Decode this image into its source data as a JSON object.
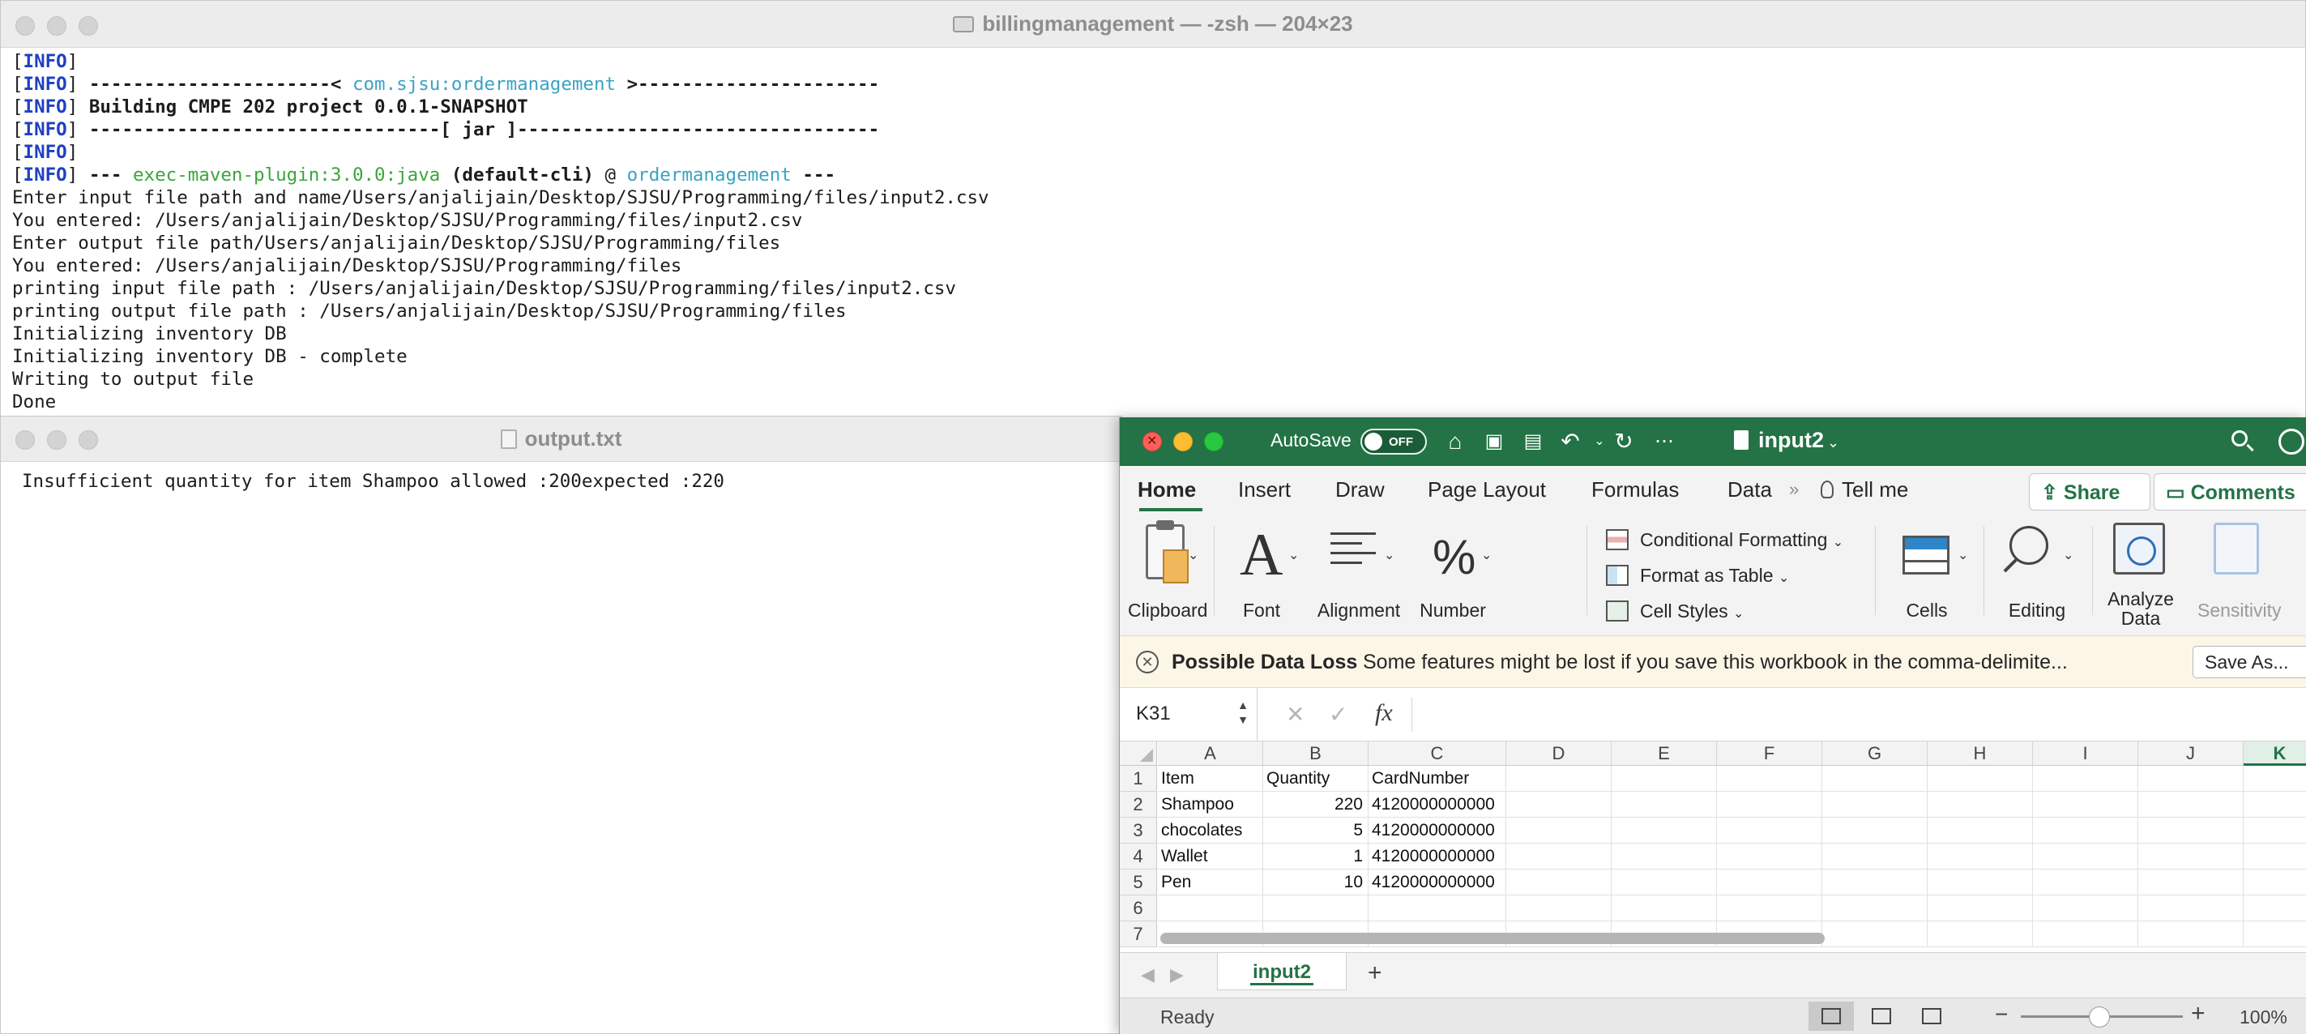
{
  "terminal": {
    "title": "billingmanagement — -zsh — 204×23",
    "lines": [
      {
        "a": "[",
        "b": "INFO",
        "c": "]",
        "d": "",
        "e": "",
        "f": "",
        "g": ""
      },
      {
        "a": "[",
        "b": "INFO",
        "c": "] ",
        "d": "----------------------< ",
        "e": "com.sjsu:ordermanagement",
        "f": " >----------------------",
        "g": ""
      },
      {
        "a": "[",
        "b": "INFO",
        "c": "] ",
        "d": "",
        "e": "",
        "f": "",
        "g": "Building CMPE 202 project 0.0.1-SNAPSHOT"
      },
      {
        "a": "[",
        "b": "INFO",
        "c": "] ",
        "d": "",
        "e": "",
        "f": "",
        "g": "--------------------------------[ jar ]---------------------------------"
      },
      {
        "a": "[",
        "b": "INFO",
        "c": "]",
        "d": "",
        "e": "",
        "f": "",
        "g": ""
      }
    ],
    "plugin_line": {
      "prefix": "[",
      "info": "INFO",
      "close": "] ",
      "dashes1": "--- ",
      "plugin": "exec-maven-plugin:3.0.0:java",
      "cli": " (default-cli)",
      "at": " @ ",
      "module": "ordermanagement",
      "dashes2": " ---"
    },
    "plain_lines": [
      "Enter input file path and name/Users/anjalijain/Desktop/SJSU/Programming/files/input2.csv",
      "You entered: /Users/anjalijain/Desktop/SJSU/Programming/files/input2.csv",
      "Enter output file path/Users/anjalijain/Desktop/SJSU/Programming/files",
      "You entered: /Users/anjalijain/Desktop/SJSU/Programming/files",
      "printing input file path : /Users/anjalijain/Desktop/SJSU/Programming/files/input2.csv",
      "printing output file path : /Users/anjalijain/Desktop/SJSU/Programming/files",
      "Initializing inventory DB",
      "Initializing inventory DB - complete",
      "Writing to output file",
      "Done"
    ]
  },
  "output_window": {
    "title": "output.txt",
    "content": "Insufficient quantity for item Shampoo allowed :200expected :220"
  },
  "excel": {
    "autosave_label": "AutoSave",
    "autosave_state": "OFF",
    "doc_name": "input2",
    "tabs": [
      "Home",
      "Insert",
      "Draw",
      "Page Layout",
      "Formulas",
      "Data"
    ],
    "tell_me": "Tell me",
    "share": "Share",
    "comments": "Comments",
    "ribbon": {
      "clipboard": "Clipboard",
      "font": "Font",
      "alignment": "Alignment",
      "number": "Number",
      "conditional_formatting": "Conditional Formatting",
      "format_as_table": "Format as Table",
      "cell_styles": "Cell Styles",
      "cells": "Cells",
      "editing": "Editing",
      "analyze_line1": "Analyze",
      "analyze_line2": "Data",
      "sensitivity": "Sensitivity"
    },
    "message": {
      "title": "Possible Data Loss",
      "text": "Some features might be lost if you save this workbook in the comma-delimite...",
      "button": "Save As..."
    },
    "name_box": "K31",
    "fx": "fx",
    "columns": [
      "A",
      "B",
      "C",
      "D",
      "E",
      "F",
      "G",
      "H",
      "I",
      "J",
      "K"
    ],
    "rows": [
      "1",
      "2",
      "3",
      "4",
      "5",
      "6",
      "7"
    ],
    "table": [
      [
        "Item",
        "Quantity",
        "CardNumber"
      ],
      [
        "Shampoo",
        "220",
        "4120000000000"
      ],
      [
        "chocolates",
        "5",
        "4120000000000"
      ],
      [
        "Wallet",
        "1",
        "4120000000000"
      ],
      [
        "Pen",
        "10",
        "4120000000000"
      ]
    ],
    "sheet_tab": "input2",
    "status": "Ready",
    "zoom": "100%",
    "colors": {
      "brand": "#237346"
    }
  }
}
